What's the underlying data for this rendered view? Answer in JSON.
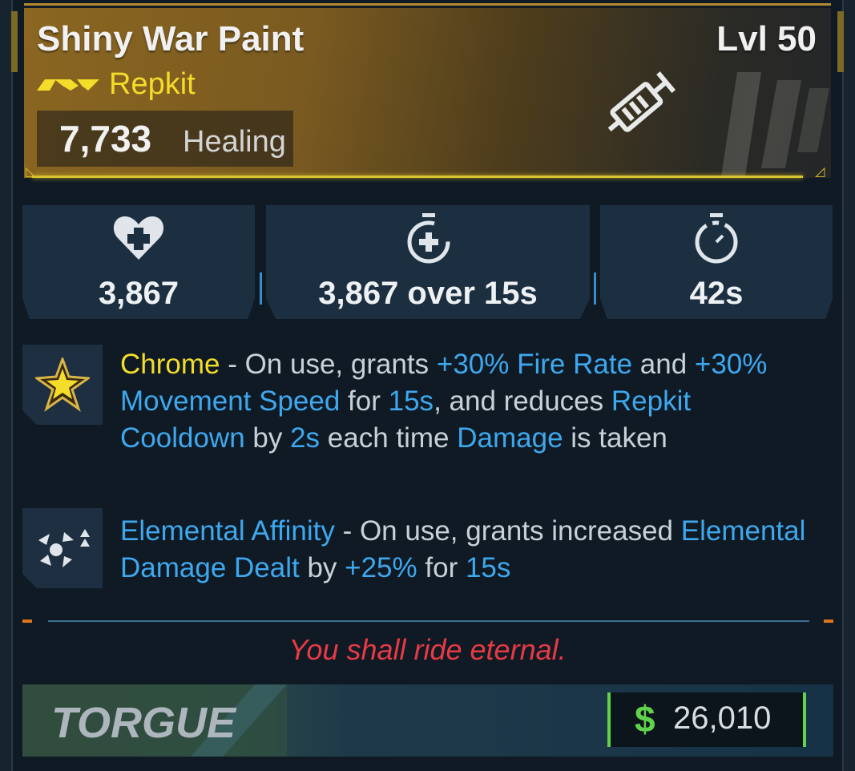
{
  "item": {
    "name": "Shiny War Paint",
    "level": "Lvl 50",
    "type": "Repkit",
    "healing_value": "7,733",
    "healing_label": "Healing",
    "rarity_color": "#f4dc2a",
    "icon": "syringe-icon"
  },
  "stats": [
    {
      "icon": "heart-plus-icon",
      "value": "3,867"
    },
    {
      "icon": "timer-plus-icon",
      "value": "3,867 over 15s"
    },
    {
      "icon": "stopwatch-icon",
      "value": "42s"
    }
  ],
  "perks": [
    {
      "icon": "chrome-star-icon",
      "name": "Chrome",
      "t1": " - On use, grants ",
      "k1": "+30% Fire Rate",
      "t2": " and ",
      "k2": "+30% Movement Speed",
      "t3": " for ",
      "k3": "15s",
      "t4": ", and reduces ",
      "k4": "Repkit Cooldown",
      "t5": " by ",
      "k5": "2s",
      "t6": " each time ",
      "k6": "Damage",
      "t7": " is taken"
    },
    {
      "icon": "elemental-affinity-icon",
      "name": "Elemental Affinity",
      "t1": " - On use, grants increased ",
      "k1": "Elemental Damage Dealt",
      "t2": " by ",
      "k2": "+25%",
      "t3": " for ",
      "k3": "15s"
    }
  ],
  "flavor_text": "You shall ride eternal.",
  "footer": {
    "manufacturer": "TORGUE",
    "currency_symbol": "$",
    "price": "26,010"
  },
  "colors": {
    "keyword_blue": "#3ea8ee",
    "keyword_yellow": "#f4dc2a",
    "flavor_red": "#e83a44",
    "price_green": "#5fd34b"
  }
}
